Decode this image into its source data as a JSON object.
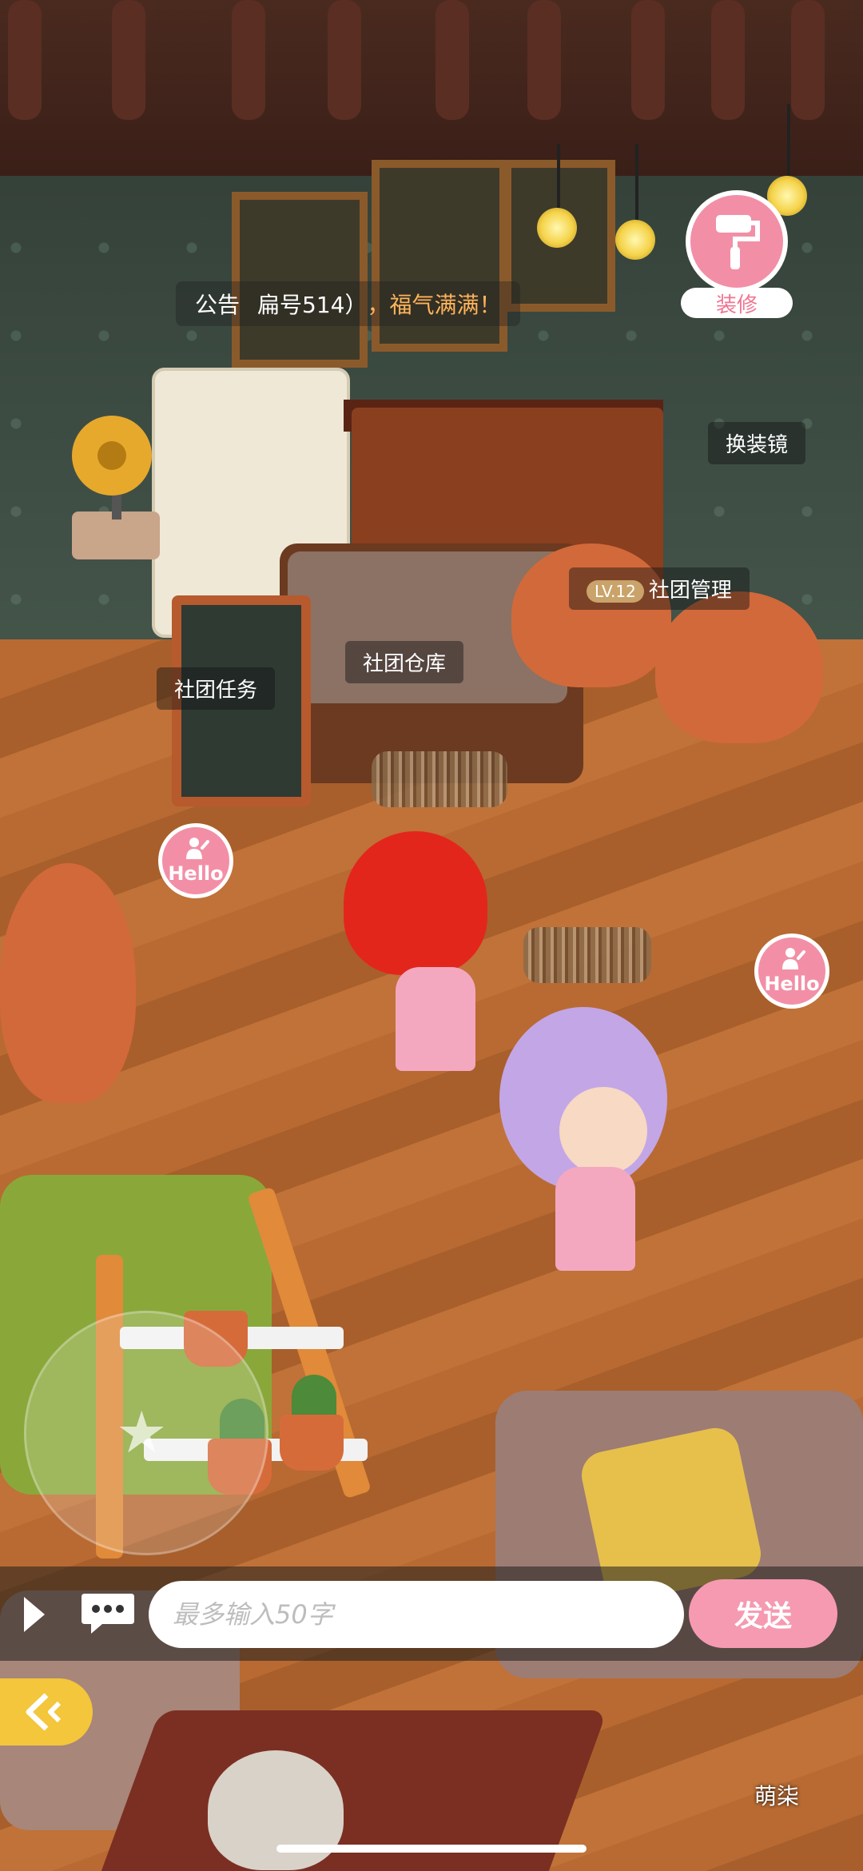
{
  "announcement": {
    "prefix": "公告",
    "text": "扁号514）",
    "highlight": "，福气满满！"
  },
  "decorate": {
    "label": "装修"
  },
  "labels": {
    "mirror": "换装镜",
    "club_manage_level": "LV.12",
    "club_manage": "社团管理",
    "club_warehouse": "社团仓库",
    "club_task": "社团任务"
  },
  "hello_buttons": [
    {
      "label": "Hello"
    },
    {
      "label": "Hello"
    }
  ],
  "chat": {
    "placeholder": "最多输入50字",
    "send_label": "发送"
  },
  "npc_name": "萌柒",
  "colors": {
    "accent_pink": "#f28fa6",
    "send_pink": "#f59ab1",
    "highlight_orange": "#ffb45a",
    "back_yellow": "#f3c63b"
  },
  "icons": {
    "decorate": "paint-roller-icon",
    "hello": "waving-person-icon",
    "chat": "speech-bubble-icon",
    "play": "play-triangle-icon",
    "back": "back-arrow-icon",
    "joystick": "star-icon"
  }
}
